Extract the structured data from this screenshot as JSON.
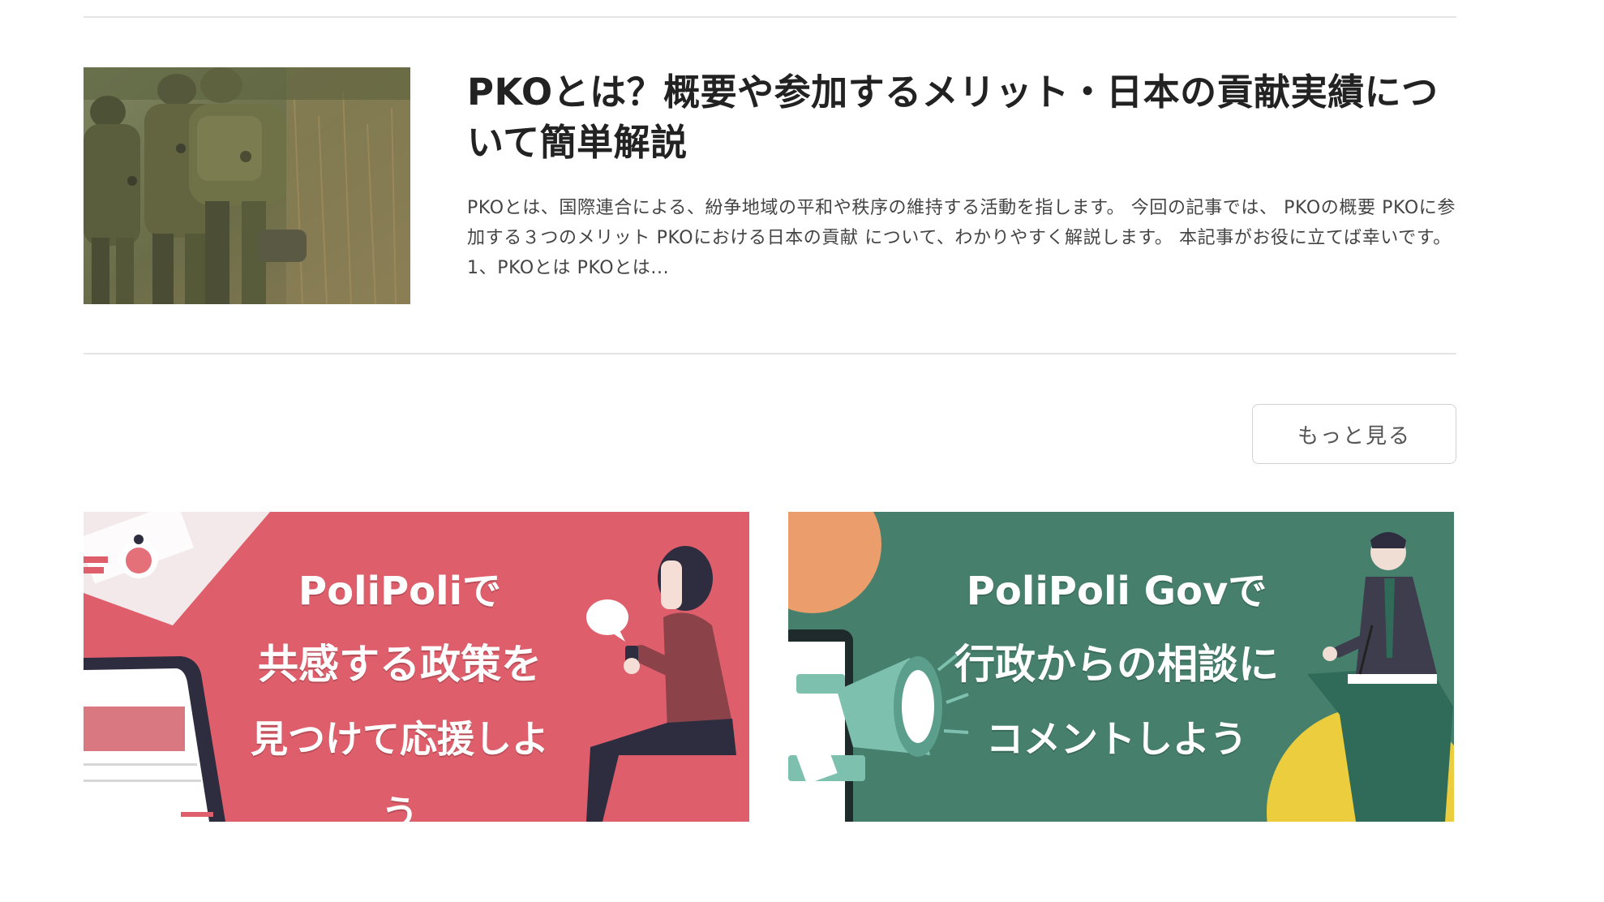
{
  "article": {
    "title": "PKOとは？概要や参加するメリット・日本の貢献実績について簡単解説",
    "excerpt": "PKOとは、国際連合による、紛争地域の平和や秩序の維持する活動を指します。 今回の記事では、 PKOの概要 PKOに参加する３つのメリット PKOにおける日本の貢献 について、わかりやすく解説します。 本記事がお役に立てば幸いです。 1、PKOとは PKOとは..."
  },
  "more_button": {
    "label": "もっと見る"
  },
  "banners": {
    "left": {
      "line1": "PoliPoliで",
      "line2": "共感する政策を",
      "line3": "見つけて応援しよう",
      "bg_color": "#de5f6b"
    },
    "right": {
      "line1": "PoliPoli Govで",
      "line2": "行政からの相談に",
      "line3": "コメントしよう",
      "bg_color": "#46806d"
    }
  },
  "colors": {
    "divider": "#e4e4e4",
    "title_text": "#222222",
    "body_text": "#444444"
  }
}
